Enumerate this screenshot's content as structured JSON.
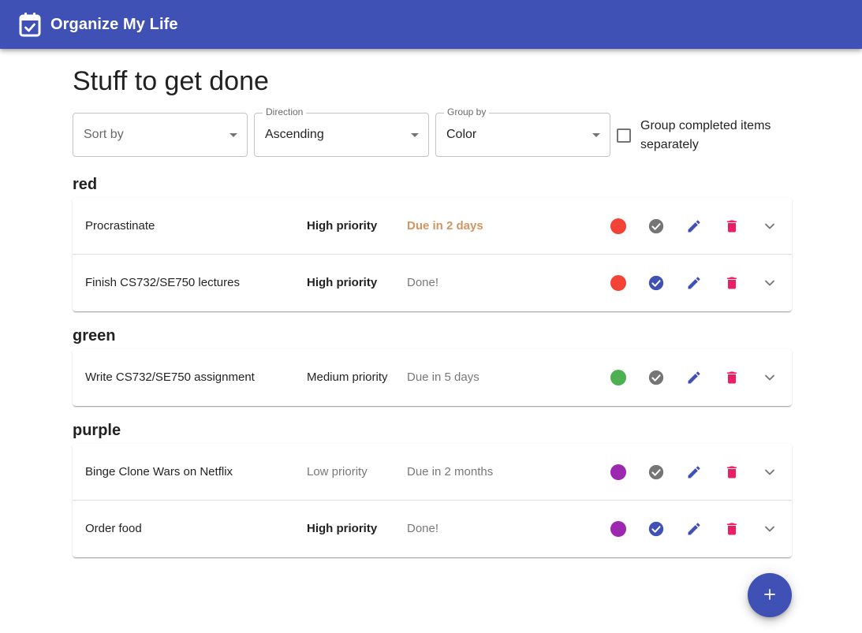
{
  "appbar": {
    "title": "Organize My Life",
    "icon": "calendar-check-icon"
  },
  "page": {
    "title": "Stuff to get done"
  },
  "controls": {
    "sort_by": {
      "label": "",
      "placeholder": "Sort by",
      "value": ""
    },
    "direction": {
      "label": "Direction",
      "value": "Ascending"
    },
    "group_by": {
      "label": "Group by",
      "value": "Color"
    },
    "group_completed": {
      "label": "Group completed items separately",
      "checked": false
    }
  },
  "colors": {
    "primary": "#3f51b5",
    "red": "#f44336",
    "green": "#4caf50",
    "purple": "#9c27b0",
    "delete": "#e91e63",
    "done": "#3f51b5",
    "not_done": "#757575"
  },
  "groups": [
    {
      "name": "red",
      "items": [
        {
          "name": "Procrastinate",
          "priority": "High priority",
          "due": "Due in 2 days",
          "color": "#f44336",
          "done": false
        },
        {
          "name": "Finish CS732/SE750 lectures",
          "priority": "High priority",
          "due": "Done!",
          "color": "#f44336",
          "done": true
        }
      ]
    },
    {
      "name": "green",
      "items": [
        {
          "name": "Write CS732/SE750 assignment",
          "priority": "Medium priority",
          "due": "Due in 5 days",
          "color": "#4caf50",
          "done": false
        }
      ]
    },
    {
      "name": "purple",
      "items": [
        {
          "name": "Binge Clone Wars on Netflix",
          "priority": "Low priority",
          "due": "Due in 2 months",
          "color": "#9c27b0",
          "done": false
        },
        {
          "name": "Order food",
          "priority": "High priority",
          "due": "Done!",
          "color": "#9c27b0",
          "done": true
        }
      ]
    }
  ],
  "fab": {
    "icon": "plus-icon"
  }
}
